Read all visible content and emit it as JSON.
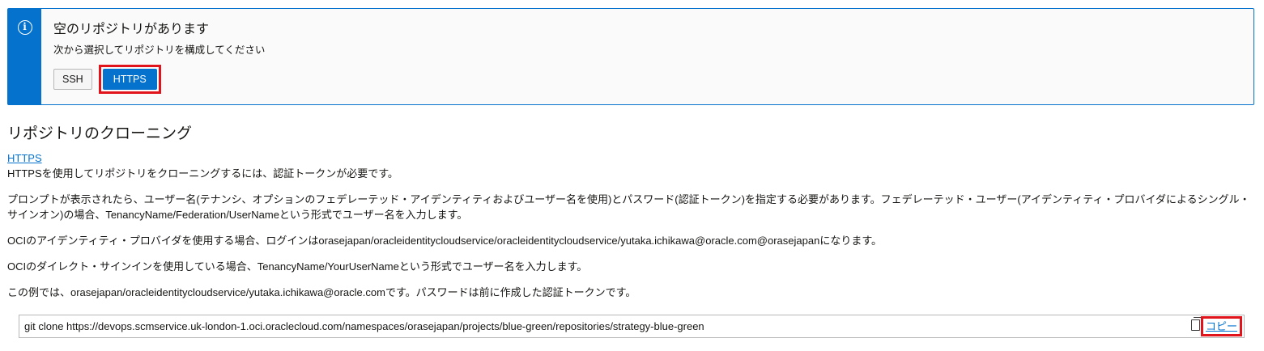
{
  "banner": {
    "icon": "info-icon",
    "title": "空のリポジトリがあります",
    "subtitle": "次から選択してリポジトリを構成してください",
    "buttons": {
      "ssh": "SSH",
      "https": "HTTPS"
    },
    "accent_color": "#0572ce"
  },
  "section": {
    "title": "リポジトリのクローニング",
    "protocol_link": "HTTPS",
    "paragraphs": [
      "HTTPSを使用してリポジトリをクローニングするには、認証トークンが必要です。",
      "プロンプトが表示されたら、ユーザー名(テナンシ、オプションのフェデレーテッド・アイデンティティおよびユーザー名を使用)とパスワード(認証トークン)を指定する必要があります。フェデレーテッド・ユーザー(アイデンティティ・プロバイダによるシングル・サインオン)の場合、TenancyName/Federation/UserNameという形式でユーザー名を入力します。",
      "OCIのアイデンティティ・プロバイダを使用する場合、ログインはorasejapan/oracleidentitycloudservice/oracleidentitycloudservice/yutaka.ichikawa@oracle.com@orasejapanになります。",
      "OCIのダイレクト・サインインを使用している場合、TenancyName/YourUserNameという形式でユーザー名を入力します。",
      "この例では、orasejapan/oracleidentitycloudservice/yutaka.ichikawa@oracle.comです。パスワードは前に作成した認証トークンです。"
    ]
  },
  "clone_command": {
    "text": "git clone https://devops.scmservice.uk-london-1.oci.oraclecloud.com/namespaces/orasejapan/projects/blue-green/repositories/strategy-blue-green",
    "copy_icon": "copy-icon",
    "copy_label": "コピー"
  },
  "highlight_color": "#e2141b"
}
